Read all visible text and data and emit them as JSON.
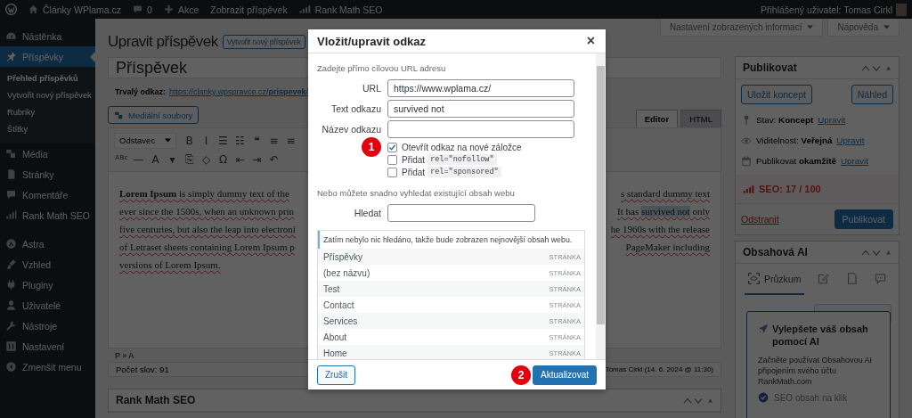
{
  "admin_bar": {
    "site": "Články WPlama.cz",
    "comments": "0",
    "new": "Akce",
    "view": "Zobrazit příspěvek",
    "seo": "Rank Math SEO",
    "user": "Přihlášený uživatel: Tomas Cirkl"
  },
  "screen_buttons": [
    "Nastavení zobrazených informací",
    "Nápověda"
  ],
  "sidebar": {
    "groups": [
      [
        {
          "label": "Nástěnka",
          "selected": false
        },
        {
          "label": "Příspěvky",
          "selected": true,
          "children": [
            {
              "label": "Přehled příspěvků",
              "selected": true
            },
            {
              "label": "Vytvořit nový příspěvek",
              "selected": false
            },
            {
              "label": "Rubriky",
              "selected": false
            },
            {
              "label": "Štítky",
              "selected": false
            }
          ]
        },
        {
          "label": "Média",
          "selected": false
        },
        {
          "label": "Stránky",
          "selected": false
        },
        {
          "label": "Komentáře",
          "selected": false
        },
        {
          "label": "Rank Math SEO",
          "selected": false
        }
      ],
      [
        {
          "label": "Astra",
          "selected": false
        },
        {
          "label": "Vzhled",
          "selected": false
        },
        {
          "label": "Pluginy",
          "selected": false
        },
        {
          "label": "Uživatelé",
          "selected": false
        },
        {
          "label": "Nástroje",
          "selected": false
        },
        {
          "label": "Nastavení",
          "selected": false
        }
      ]
    ],
    "collapse": "Zmenšit menu"
  },
  "editor": {
    "heading": "Upravit příspěvek",
    "new_button": "Vytvořit nový příspěvek",
    "post_title": "Příspěvek",
    "permalink_label": "Trvalý odkaz:",
    "permalink_url": "https://clanky.wpspravce.cz/**prispevek**/",
    "media_button": "Mediální soubory",
    "tabs": [
      {
        "label": "Editor",
        "selected": true
      },
      {
        "label": "HTML",
        "selected": false
      }
    ],
    "format_select": "Odstavec",
    "toolbar_row1": [
      "B",
      "I",
      "☰",
      "☷",
      "❝",
      "≡",
      "≡"
    ],
    "toolbar_row2": [
      "ᴬᴮᶜ",
      "—",
      "A",
      "▾",
      "⎘",
      "◇",
      "Ω",
      "⇤",
      "⇥",
      "↶"
    ],
    "lines": [
      {
        "left": "**Lorem Ipsum** is simply dummy text of the",
        "right": [
          {
            "text": "s standard dummy text",
            "selected": false
          }
        ]
      },
      {
        "left": "ever since the 1500s, when an unknown prin",
        "right": [
          {
            "text": "It has ",
            "selected": false
          },
          {
            "text": "survived not",
            "selected": true
          },
          {
            "text": " only",
            "selected": false
          }
        ]
      },
      {
        "left": "five centuries, but also the leap into electroni",
        "right": [
          {
            "text": "he 1960s with the release",
            "selected": false
          }
        ]
      },
      {
        "left": "of Letraset sheets containing Lorem Ipsum p",
        "right": [
          {
            "text": "PageMaker including",
            "selected": false
          }
        ]
      },
      {
        "left": "versions of Lorem Ipsum."
      }
    ],
    "path": "P » A",
    "word_count": "Počet slov: 91",
    "last_edit": "Tomas Cirkl (14. 6. 2024 @ 11:30)"
  },
  "rank_math_box": {
    "title": "Rank Math SEO"
  },
  "publish": {
    "title": "Publikovat",
    "save_button": "Uložit koncept",
    "preview_button": "Náhled",
    "rows": [
      {
        "text": "Stav: **Koncept**",
        "link": "Upravit"
      },
      {
        "text": "Viditelnost: **Veřejná**",
        "link": "Upravit"
      },
      {
        "text": "Publikovat **okamžitě**",
        "link": "Upravit"
      }
    ],
    "seo": "SEO: 17 / 100",
    "delete_link": "Odstranit",
    "publish_button": "Publikovat"
  },
  "content_ai": {
    "title": "Obsahová AI",
    "tabs": [
      {
        "label": "Průzkum",
        "selected": true
      },
      {
        "selected": false
      },
      {
        "selected": false
      },
      {
        "selected": false
      }
    ],
    "popup": {
      "title": "Vylepšete váš obsah pomocí AI",
      "text": "Začněte používat Obsahovou AI připojením svého účtu RankMath.com",
      "feature": "SEO obsah na klik"
    }
  },
  "dialog": {
    "title": "Vložit/upravit odkaz",
    "close": "×",
    "intro": "Zadejte přímo cílovou URL adresu",
    "fields": [
      {
        "label": "URL",
        "value": "https://www.wplama.cz/"
      },
      {
        "label": "Text odkazu",
        "value": "survived not"
      },
      {
        "label": "Název odkazu"
      }
    ],
    "options": [
      {
        "label": "Otevřít odkaz na nové záložce",
        "checked": true
      },
      {
        "label": "Přidat",
        "code": "rel=\"nofollow\"",
        "checked": false
      },
      {
        "label": "Přidat",
        "code": "rel=\"sponsored\"",
        "checked": false
      }
    ],
    "search_intro": "Nebo můžete snadno vyhledat existující obsah webu",
    "search_label": "Hledat",
    "results_notice": "Zatím nebylo nic hledáno, takže bude zobrazen nejnovější obsah webu.",
    "results": [
      {
        "title": "Příspěvky",
        "type": "STRÁNKA"
      },
      {
        "title": "(bez názvu)",
        "type": "STRÁNKA"
      },
      {
        "title": "Test",
        "type": "STRÁNKA"
      },
      {
        "title": "Contact",
        "type": "STRÁNKA"
      },
      {
        "title": "Services",
        "type": "STRÁNKA"
      },
      {
        "title": "About",
        "type": "STRÁNKA"
      },
      {
        "title": "Home",
        "type": "STRÁNKA"
      }
    ],
    "cancel": "Zrušit",
    "submit": "Aktualizovat",
    "markers": [
      "1",
      "2"
    ]
  }
}
